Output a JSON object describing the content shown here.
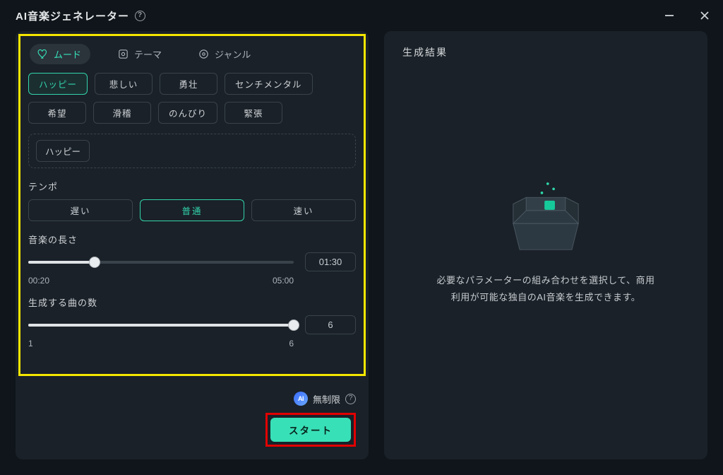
{
  "window": {
    "title": "AI音楽ジェネレーター"
  },
  "categories": {
    "mood": {
      "label": "ムード"
    },
    "theme": {
      "label": "テーマ"
    },
    "genre": {
      "label": "ジャンル"
    }
  },
  "moods": {
    "happy": "ハッピー",
    "sad": "悲しい",
    "heroic": "勇壮",
    "sentimental": "センチメンタル",
    "hope": "希望",
    "comical": "滑稽",
    "laidback": "のんびり",
    "tense": "緊張"
  },
  "selected_tags": {
    "tag1": "ハッピー"
  },
  "tempo": {
    "label": "テンポ",
    "slow": "遅い",
    "normal": "普通",
    "fast": "速い"
  },
  "length": {
    "label": "音楽の長さ",
    "min": "00:20",
    "max": "05:00",
    "value": "01:30",
    "fill_pct": "25%",
    "thumb_pct": "25%"
  },
  "count": {
    "label": "生成する曲の数",
    "min": "1",
    "max": "6",
    "value": "6",
    "fill_pct": "100%",
    "thumb_pct": "100%"
  },
  "footer": {
    "ai_badge": "AI",
    "unlimited": "無制限",
    "start": "スタート"
  },
  "right": {
    "title": "生成結果",
    "empty_line1": "必要なパラメーターの組み合わせを選択して、商用",
    "empty_line2": "利用が可能な独自のAI音楽を生成できます。"
  }
}
